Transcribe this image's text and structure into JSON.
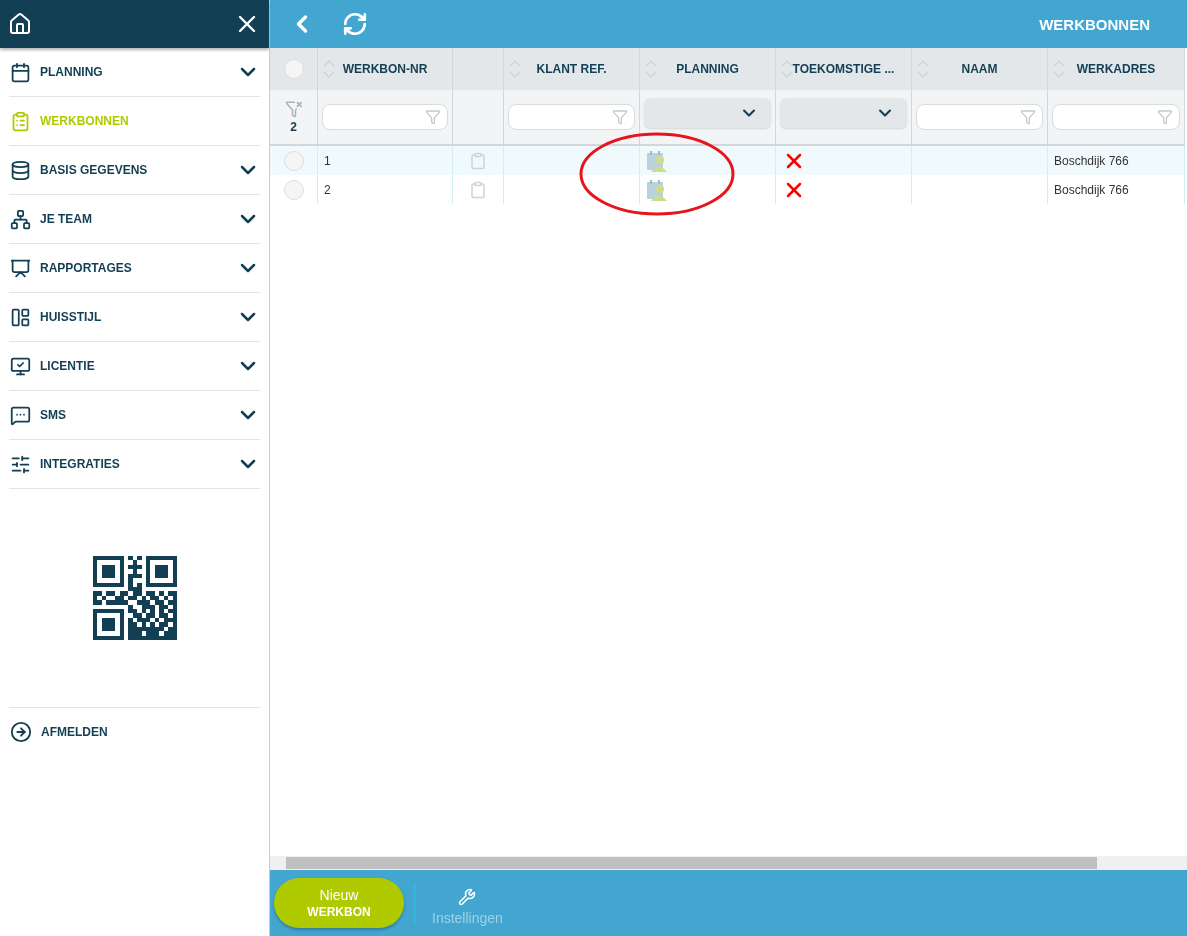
{
  "sidebar": {
    "items": [
      {
        "label": "PLANNING",
        "selected": false,
        "expandable": true
      },
      {
        "label": "WERKBONNEN",
        "selected": true,
        "expandable": false
      },
      {
        "label": "BASIS GEGEVENS",
        "selected": false,
        "expandable": true
      },
      {
        "label": "JE TEAM",
        "selected": false,
        "expandable": true
      },
      {
        "label": "RAPPORTAGES",
        "selected": false,
        "expandable": true
      },
      {
        "label": "HUISSTIJL",
        "selected": false,
        "expandable": true
      },
      {
        "label": "LICENTIE",
        "selected": false,
        "expandable": true
      },
      {
        "label": "SMS",
        "selected": false,
        "expandable": true
      },
      {
        "label": "INTEGRATIES",
        "selected": false,
        "expandable": true
      }
    ],
    "logout": "AFMELDEN"
  },
  "header": {
    "title": "WERKBONNEN"
  },
  "table": {
    "filter_count": "2",
    "all_selected": false,
    "columns": [
      {
        "label": "WERKBON-NR",
        "sortable": true
      },
      {
        "sortable": false
      },
      {
        "label": "KLANT REF.",
        "sortable": true
      },
      {
        "label": "PLANNING",
        "sortable": true
      },
      {
        "label": "TOEKOMSTIGE ...",
        "sortable": true
      },
      {
        "label": "NAAM",
        "sortable": true
      },
      {
        "label": "WERKADRES",
        "sortable": true
      }
    ],
    "filters": [
      {
        "kind": "text"
      },
      {
        "kind": "none"
      },
      {
        "kind": "text"
      },
      {
        "kind": "dropdown"
      },
      {
        "kind": "dropdown"
      },
      {
        "kind": "text"
      },
      {
        "kind": "text"
      }
    ],
    "rows": [
      {
        "selected": false,
        "werkbon_nr": "1",
        "future": false,
        "werkadres": "Boschdijk 766"
      },
      {
        "selected": false,
        "werkbon_nr": "2",
        "future": false,
        "werkadres": "Boschdijk 766"
      }
    ]
  },
  "footer": {
    "new_button": {
      "line_1": "Nieuw",
      "line_2": "WERKBON"
    },
    "settings": {
      "label": "Instellingen",
      "disabled": true
    }
  }
}
